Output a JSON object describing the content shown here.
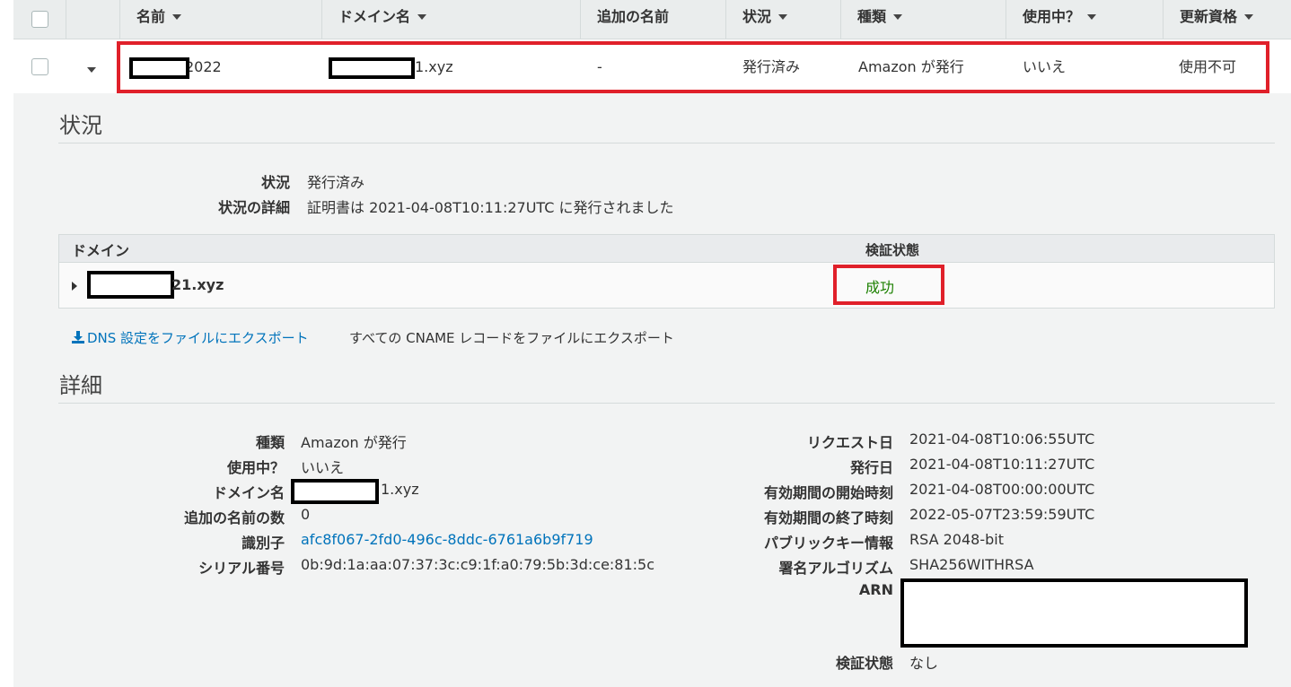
{
  "table": {
    "columns": [
      {
        "label": "名前",
        "sortable": true
      },
      {
        "label": "ドメイン名",
        "sortable": true
      },
      {
        "label": "追加の名前",
        "sortable": false
      },
      {
        "label": "状況",
        "sortable": true
      },
      {
        "label": "種類",
        "sortable": true
      },
      {
        "label": "使用中？",
        "sortable": true
      },
      {
        "label": "更新資格",
        "sortable": true
      }
    ],
    "row": {
      "name_suffix": "2022",
      "domain_suffix": "1.xyz",
      "additional_names": "-",
      "status": "発行済み",
      "type": "Amazon が発行",
      "in_use": "いいえ",
      "renewal": "使用不可"
    }
  },
  "status_section": {
    "title": "状況",
    "status_label": "状況",
    "status_value": "発行済み",
    "detail_label": "状況の詳細",
    "detail_value": "証明書は 2021-04-08T10:11:27UTC に発行されました"
  },
  "domain_table": {
    "col_domain": "ドメイン",
    "col_validation": "検証状態",
    "row_domain_suffix": "21.xyz",
    "row_validation": "成功"
  },
  "exports": {
    "dns_export": "DNS 設定をファイルにエクスポート",
    "cname_export": "すべての CNAME レコードをファイルにエクスポート"
  },
  "details": {
    "title": "詳細",
    "left": [
      {
        "label": "種類",
        "value": "Amazon が発行"
      },
      {
        "label": "使用中？",
        "value": "いいえ"
      },
      {
        "label": "ドメイン名",
        "value": "1.xyz"
      },
      {
        "label": "追加の名前の数",
        "value": "0"
      },
      {
        "label": "識別子",
        "value": "afc8f067-2fd0-496c-8ddc-6761a6b9f719"
      },
      {
        "label": "シリアル番号",
        "value": "0b:9d:1a:aa:07:37:3c:c9:1f:a0:79:5b:3d:ce:81:5c"
      }
    ],
    "right": [
      {
        "label": "リクエスト日",
        "value": "2021-04-08T10:06:55UTC"
      },
      {
        "label": "発行日",
        "value": "2021-04-08T10:11:27UTC"
      },
      {
        "label": "有効期間の開始時刻",
        "value": "2021-04-08T00:00:00UTC"
      },
      {
        "label": "有効期間の終了時刻",
        "value": "2022-05-07T23:59:59UTC"
      },
      {
        "label": "パブリックキー情報",
        "value": "RSA 2048-bit"
      },
      {
        "label": "署名アルゴリズム",
        "value": "SHA256WITHRSA"
      },
      {
        "label": "ARN",
        "value": ""
      },
      {
        "label": "検証状態",
        "value": "なし"
      }
    ]
  },
  "colors": {
    "success_green": "#1d8102",
    "link_blue": "#0073bb",
    "highlight_red": "#e0202a"
  }
}
